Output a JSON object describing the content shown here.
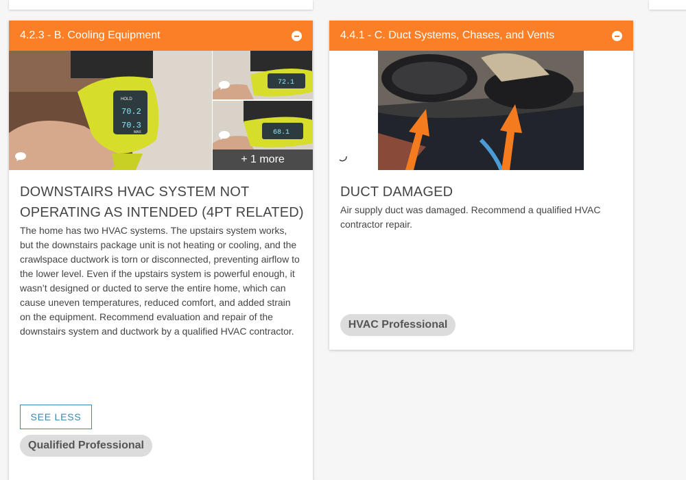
{
  "cards": [
    {
      "header": "4.2.3 - B. Cooling Equipment",
      "title": "DOWNSTAIRS HVAC SYSTEM NOT OPERATING AS INTENDED (4PT RELATED)",
      "body": "The home has two HVAC systems. The upstairs system works, but the downstairs package unit is not heating or cooling, and the crawlspace ductwork is torn or disconnected, preventing airflow to the lower level. Even if the upstairs system is powerful enough, it wasn’t designed or ducted to serve the entire home, which can cause uneven temperatures, reduced comfort, and added strain on the equipment. Recommend evaluation and repair of the downstairs system and ductwork by a qualified HVAC contractor.",
      "more_photos": "+ 1 more",
      "see_less": "SEE LESS",
      "tag": "Qualified Professional",
      "thermometer_readings": {
        "main_top": "70.2",
        "main_bottom": "70.3",
        "thumb1": "72.1",
        "thumb2": "68.1"
      },
      "thermometer_labels": {
        "hold": "HOLD",
        "max": "MAX"
      }
    },
    {
      "header": "4.4.1 - C. Duct Systems, Chases, and Vents",
      "title": "DUCT DAMAGED",
      "body": "Air supply duct was damaged. Recommend a qualified HVAC contractor repair.",
      "tag": "HVAC Professional"
    }
  ],
  "colors": {
    "accent": "#fa7f26",
    "link": "#3b86b0",
    "tag_bg": "#dcdcdc"
  },
  "icons": {
    "collapse": "minus-circle-icon",
    "comment": "speech-bubble-icon",
    "loading": "spinner-icon"
  }
}
